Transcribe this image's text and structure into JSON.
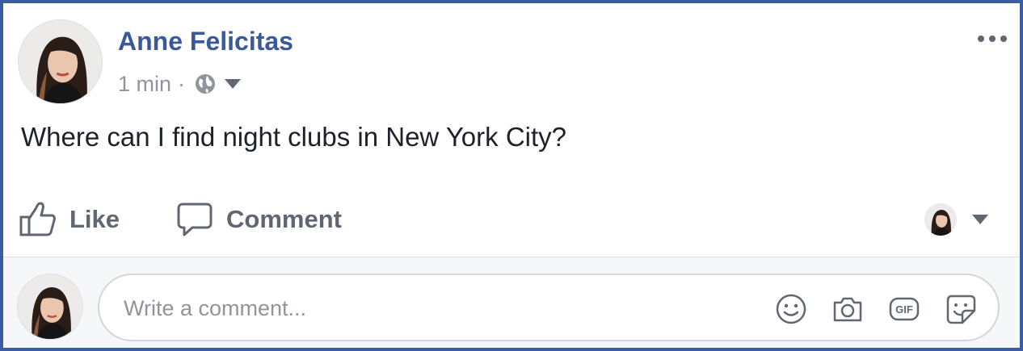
{
  "post": {
    "author": "Anne Felicitas",
    "timestamp": "1 min",
    "separator": "·",
    "privacy_icon": "globe-icon",
    "text": "Where can I find night clubs in New York City?"
  },
  "actions": {
    "like_label": "Like",
    "comment_label": "Comment"
  },
  "comment_box": {
    "placeholder": "Write a comment...",
    "icons": [
      "emoji-icon",
      "camera-icon",
      "gif-icon",
      "sticker-icon"
    ],
    "gif_text": "GIF"
  },
  "colors": {
    "frame_border": "#3b5ba5",
    "author_link": "#3b5998",
    "secondary_text": "#90949c",
    "action_text": "#606770",
    "body_text": "#1d2129"
  }
}
